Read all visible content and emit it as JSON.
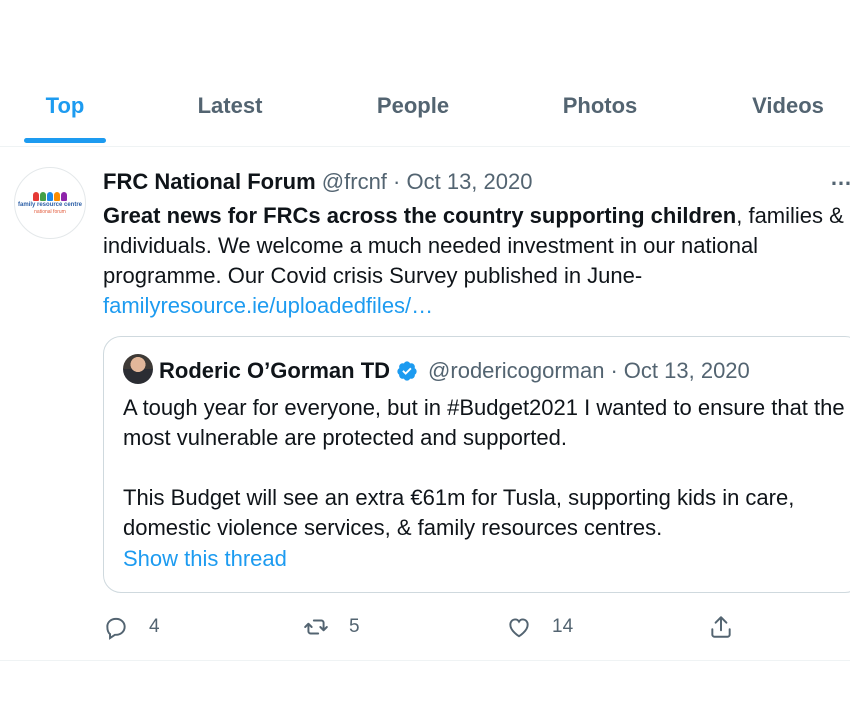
{
  "tabs": [
    "Top",
    "Latest",
    "People",
    "Photos",
    "Videos"
  ],
  "active_tab": "Top",
  "tweet": {
    "avatar": {
      "line1": "family resource centre",
      "line2": "national forum",
      "colors": [
        "#e53935",
        "#43a047",
        "#1e88e5",
        "#fb8c00",
        "#8e24aa"
      ]
    },
    "author_name": "FRC National Forum",
    "handle": "@frcnf",
    "separator": "·",
    "date": "Oct 13, 2020",
    "more_icon": "…",
    "text_bold": "Great news for FRCs across the country supporting children",
    "text_rest": ", families & individuals. We welcome a much needed investment in our national programme. Our Covid crisis Survey published in June-",
    "link": "familyresource.ie/uploadedfiles/…",
    "quote": {
      "author_name": "Roderic O’Gorman TD",
      "verified": true,
      "handle": "@rodericogorman",
      "separator": "·",
      "date": "Oct 13, 2020",
      "paragraph1": "A tough year for everyone, but in #Budget2021 I wanted to ensure that the most vulnerable are protected and supported.",
      "paragraph2": "This Budget will see an extra €61m for Tusla, supporting kids in care, domestic violence services, & family resources centres.",
      "show_thread": "Show this thread"
    },
    "actions": {
      "replies": "4",
      "retweets": "5",
      "likes": "14"
    }
  },
  "colors": {
    "accent": "#1d9bf0",
    "muted": "#536471",
    "text": "#0f1419",
    "border": "#cfd9de"
  }
}
